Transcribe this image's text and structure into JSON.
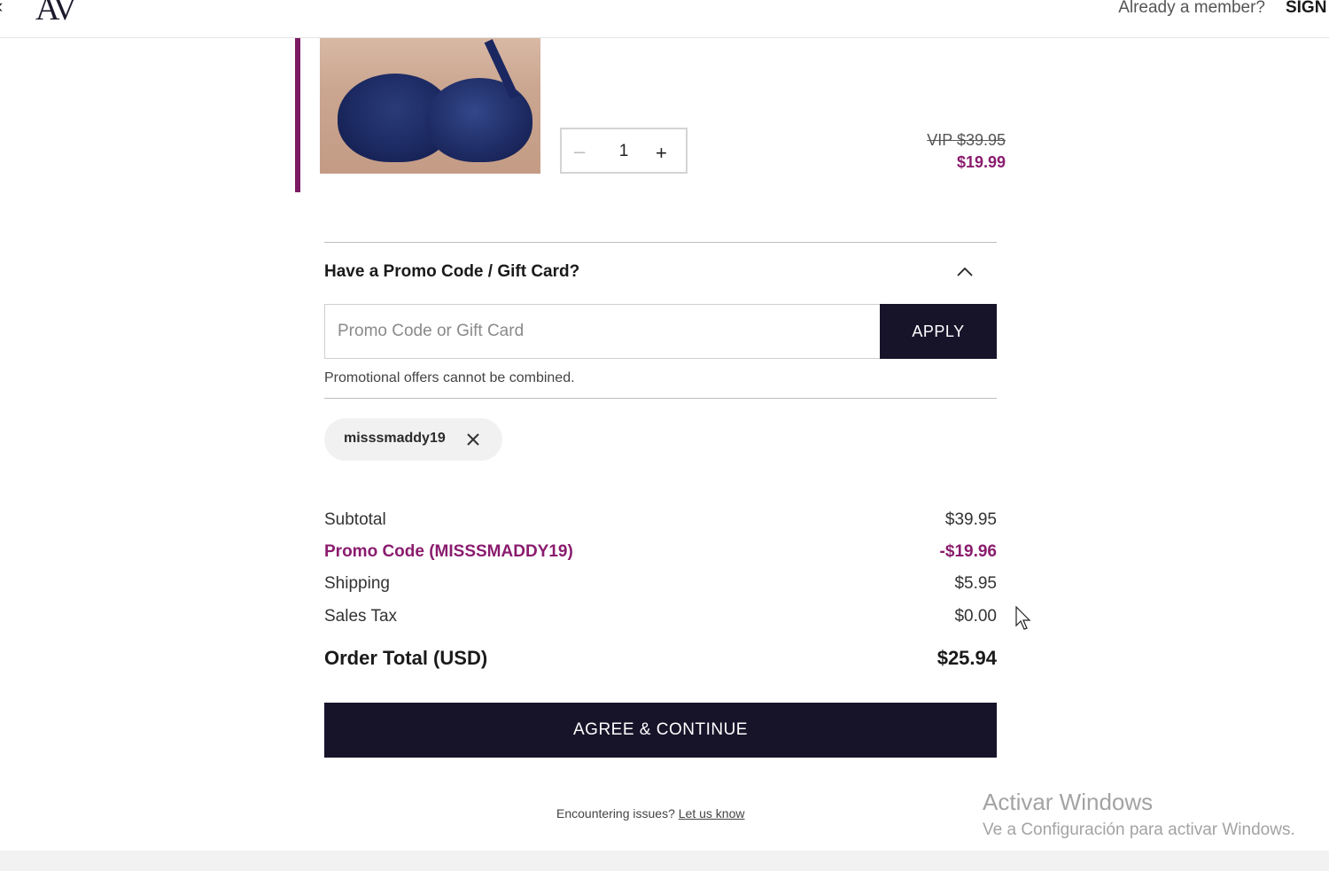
{
  "header": {
    "back_glyph": "‹",
    "logo_text": "AV",
    "member_prompt": "Already a member?",
    "sign_in_label": "SIGN I"
  },
  "product": {
    "image_alt": "Navy lace bra",
    "quantity": "1",
    "minus_glyph": "–",
    "plus_glyph": "+",
    "price_original": "VIP $39.95",
    "price_sale": "$19.99"
  },
  "promo": {
    "heading": "Have a Promo Code / Gift Card?",
    "input_placeholder": "Promo Code or Gift Card",
    "input_value": "",
    "apply_label": "APPLY",
    "note": "Promotional offers cannot be combined.",
    "applied_code": "misssmaddy19"
  },
  "summary": {
    "rows": [
      {
        "label": "Subtotal",
        "value": "$39.95"
      },
      {
        "label": "Promo Code (MISSSMADDY19)",
        "value": "-$19.96"
      },
      {
        "label": "Shipping",
        "value": "$5.95"
      },
      {
        "label": "Sales Tax",
        "value": "$0.00"
      }
    ],
    "total_label": "Order Total (USD)",
    "total_value": "$25.94"
  },
  "actions": {
    "continue_label": "AGREE & CONTINUE"
  },
  "help": {
    "prefix": "Encountering issues?",
    "link_label": "Let us know"
  },
  "watermark": {
    "title": "Activar Windows",
    "subtitle": "Ve a Configuración para activar Windows."
  },
  "colors": {
    "brand_dark": "#17142a",
    "accent_plum": "#8a1c6e"
  },
  "icons": {
    "collapse": "chevron-up-icon",
    "remove_code": "close-icon",
    "back": "chevron-left-icon"
  }
}
